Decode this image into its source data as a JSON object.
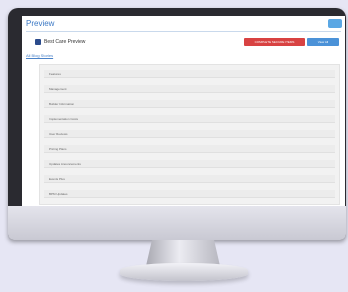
{
  "app": {
    "title": "Preview"
  },
  "document": {
    "title": "Best Care Preview"
  },
  "toolbar": {
    "primary_action": "COMPLETE SECURE ITEMS",
    "secondary_action": "View All"
  },
  "breadcrumb": {
    "link": "All Blog Stories"
  },
  "list": {
    "items": [
      "Features",
      "Management",
      "Builder Information",
      "Implementation Costs",
      "User Reviews",
      "Pricing Plans",
      "Updates Anouncements",
      "Events Plus",
      "BPM Updates"
    ]
  },
  "colors": {
    "accent_blue": "#4b92d8",
    "action_red": "#d84242",
    "bezel": "#2a2a30",
    "background": "#e6e6f4"
  }
}
